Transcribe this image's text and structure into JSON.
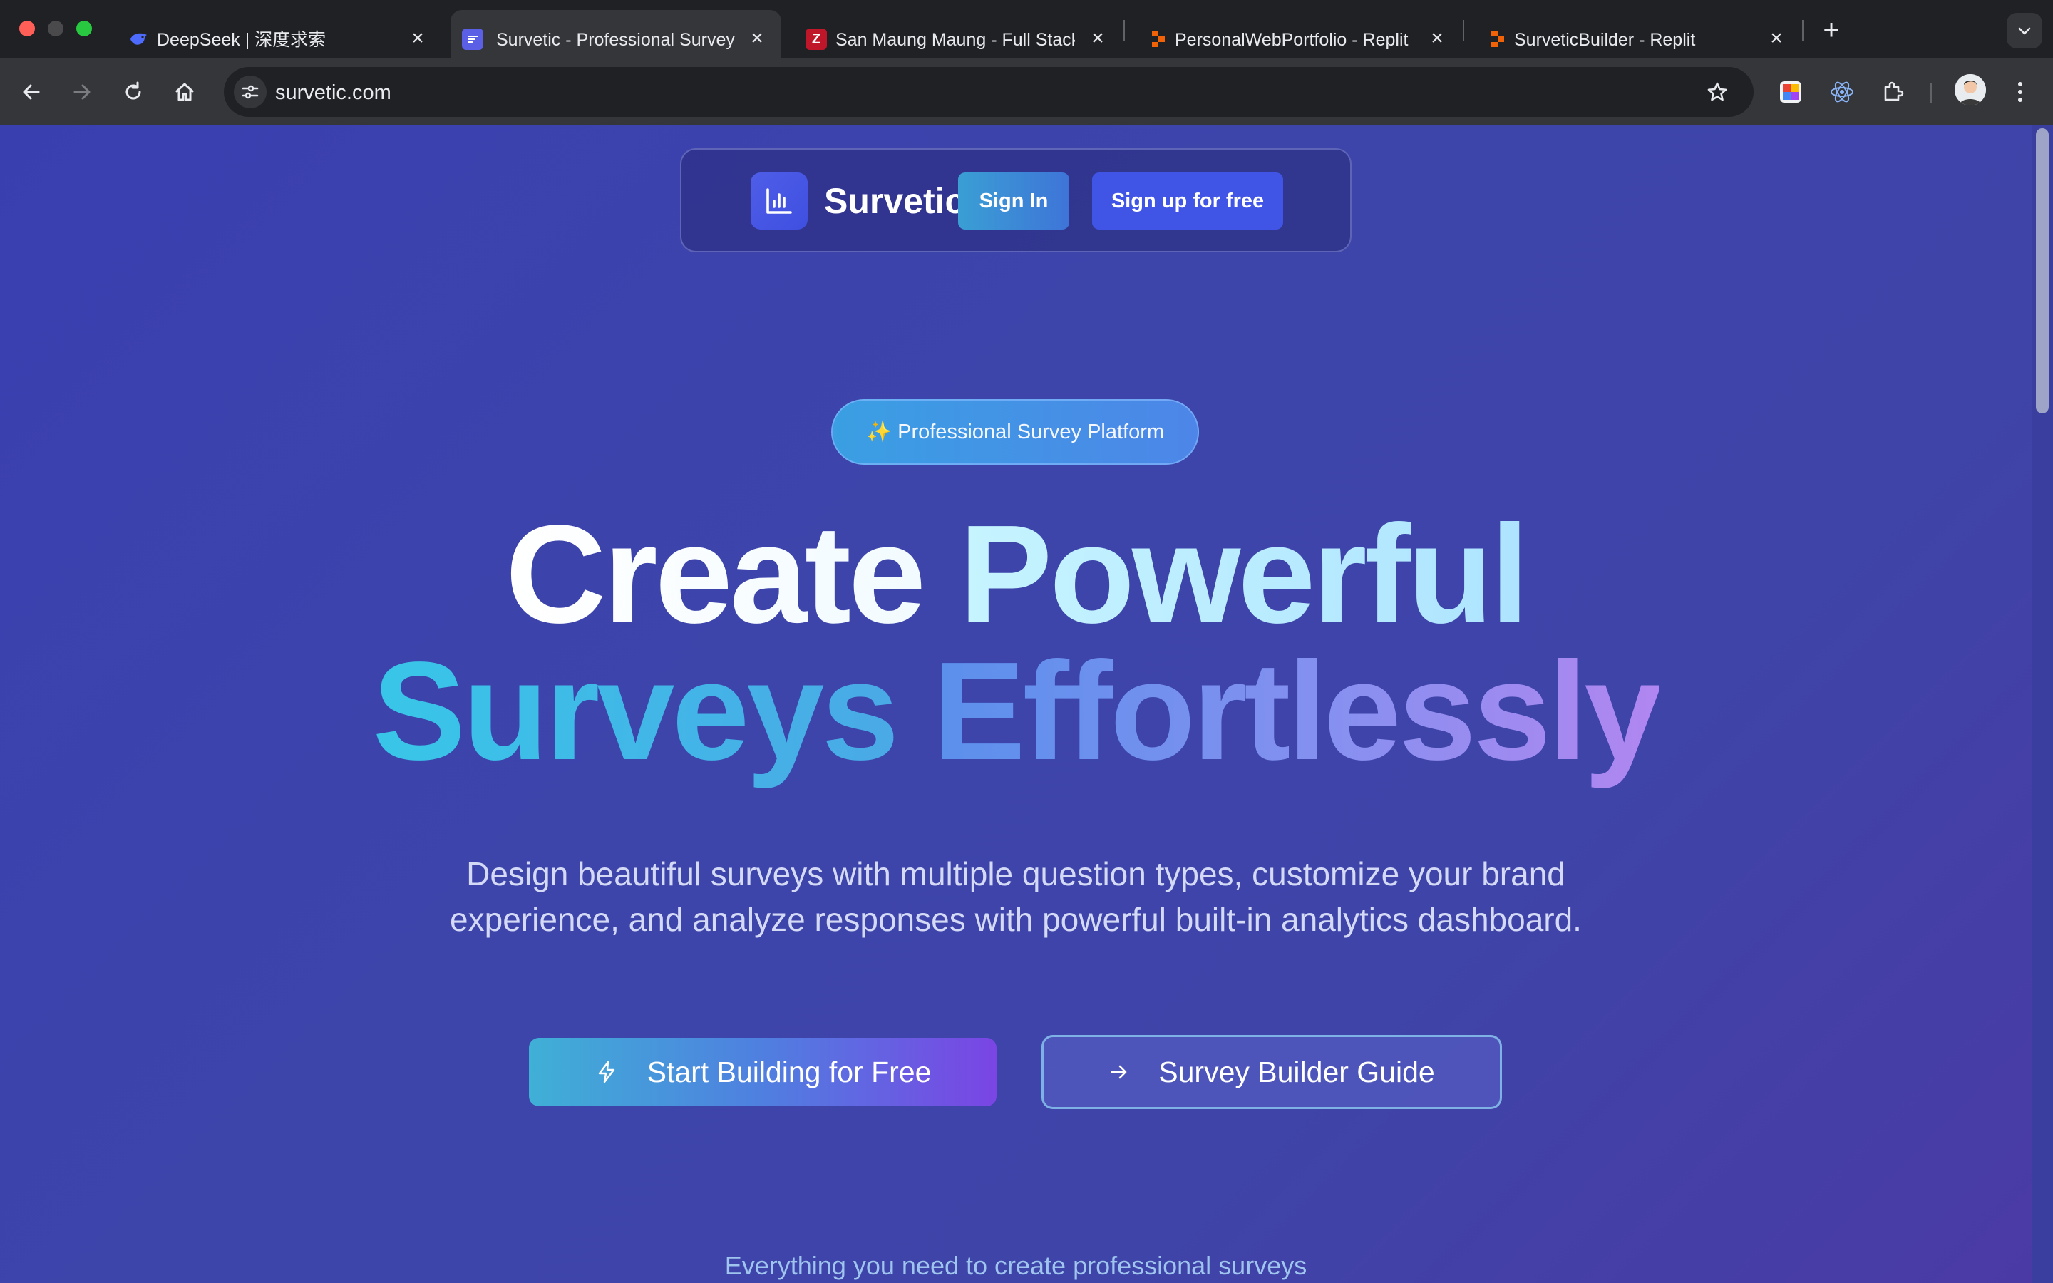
{
  "browser": {
    "tabs": [
      {
        "title": "DeepSeek | 深度求索",
        "favicon": "deepseek-whale-icon",
        "active": false
      },
      {
        "title": "Survetic - Professional Survey",
        "favicon": "survetic-doc-icon",
        "active": true
      },
      {
        "title": "San Maung Maung - Full Stack",
        "favicon": "z-letter-icon",
        "active": false
      },
      {
        "title": "PersonalWebPortfolio - Replit",
        "favicon": "replit-icon",
        "active": false
      },
      {
        "title": "SurveticBuilder - Replit",
        "favicon": "replit-icon",
        "active": false
      }
    ],
    "address": "survetic.com",
    "colors": {
      "chrome": "#202124",
      "toolbar": "#35363a",
      "text": "#e8eaed"
    }
  },
  "page": {
    "brand": "Survetic",
    "nav": {
      "signin": "Sign In",
      "signup": "Sign up for free"
    },
    "badge": "✨ Professional Survey Platform",
    "headline": {
      "line1_a": "Create",
      "line1_b": "Powerful",
      "line2_a": "Surveys",
      "line2_b": "Effortlessly"
    },
    "subtitle_line1": "Design beautiful surveys with multiple question types, customize your brand",
    "subtitle_line2": "experience, and analyze responses with powerful built-in analytics dashboard.",
    "cta": {
      "primary": "Start Building for Free",
      "secondary": "Survey Builder Guide"
    },
    "section_hint": "Everything you need to create professional surveys",
    "colors": {
      "background": "#3d43ab",
      "accent": "#4055e6",
      "cyan": "#38c6e8",
      "purple": "#b186f0"
    }
  }
}
